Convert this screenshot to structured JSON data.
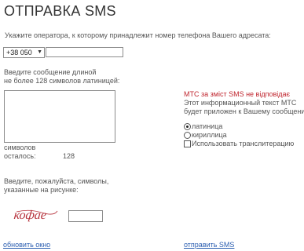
{
  "page": {
    "title": "ОТПРАВКА SMS",
    "operator_hint": "Укажите оператора, к которому принадлежит номер телефона Вашего адресата:"
  },
  "operator_select": {
    "value": "+38 050"
  },
  "phone_input": {
    "value": ""
  },
  "message": {
    "label_line1": "Введите сообщение длиной",
    "label_line2": "не более 128  символов латиницей:",
    "value": ""
  },
  "counter": {
    "label_line1": "символов",
    "label_line2": "осталось:",
    "value": "128"
  },
  "notice": {
    "title": "МТС за зміст SMS не відповідає",
    "line1": "Этот информационный текст МТС",
    "line2": "будет приложен к Вашему сообщению"
  },
  "encoding": {
    "selected": "latin",
    "options": [
      {
        "id": "latin",
        "label": "латиница"
      },
      {
        "id": "cyrillic",
        "label": "кириллица"
      }
    ],
    "translit_label": "Использовать транслитерацию"
  },
  "captcha": {
    "label_line1": "Введите, пожалуйста, символы,",
    "label_line2": "указанные на рисунке:",
    "image_text": "кофае",
    "input_value": ""
  },
  "actions": {
    "refresh_label": "обновить окно",
    "send_label": "отправить SMS"
  },
  "colors": {
    "link": "#2a5db0",
    "notice_red": "#c0262f",
    "captcha": "#b5303a"
  }
}
